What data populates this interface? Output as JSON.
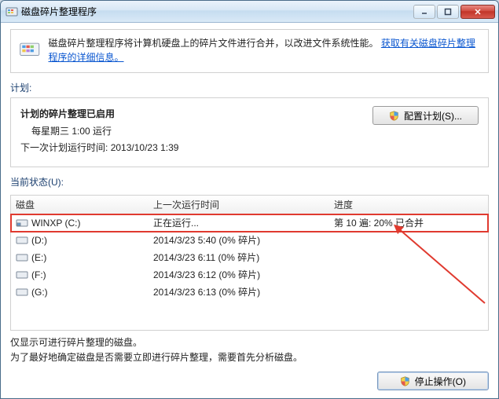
{
  "window": {
    "title": "磁盘碎片整理程序"
  },
  "info": {
    "text_plain": "磁盘碎片整理程序将计算机硬盘上的碎片文件进行合并，以改进文件系统性能。",
    "link_text": "获取有关磁盘碎片整理程序的详细信息。"
  },
  "schedule": {
    "label": "计划:",
    "enabled_title": "计划的碎片整理已启用",
    "frequency": "每星期三   1:00 运行",
    "next_run_label": "下一次计划运行时间:",
    "next_run_value": "2013/10/23 1:39",
    "config_button": "配置计划(S)..."
  },
  "status": {
    "label": "当前状态(U):",
    "columns": {
      "disk": "磁盘",
      "last": "上一次运行时间",
      "progress": "进度"
    },
    "rows": [
      {
        "disk": "WINXP (C:)",
        "last": "正在运行...",
        "progress": "第 10 遍: 20% 已合并",
        "highlight": true
      },
      {
        "disk": "(D:)",
        "last": "2014/3/23 5:40 (0% 碎片)",
        "progress": ""
      },
      {
        "disk": "(E:)",
        "last": "2014/3/23 6:11 (0% 碎片)",
        "progress": ""
      },
      {
        "disk": "(F:)",
        "last": "2014/3/23 6:12 (0% 碎片)",
        "progress": ""
      },
      {
        "disk": "(G:)",
        "last": "2014/3/23 6:13 (0% 碎片)",
        "progress": ""
      }
    ]
  },
  "notes": {
    "line1": "仅显示可进行碎片整理的磁盘。",
    "line2": "为了最好地确定磁盘是否需要立即进行碎片整理，需要首先分析磁盘。"
  },
  "footer": {
    "stop_button": "停止操作(O)"
  }
}
